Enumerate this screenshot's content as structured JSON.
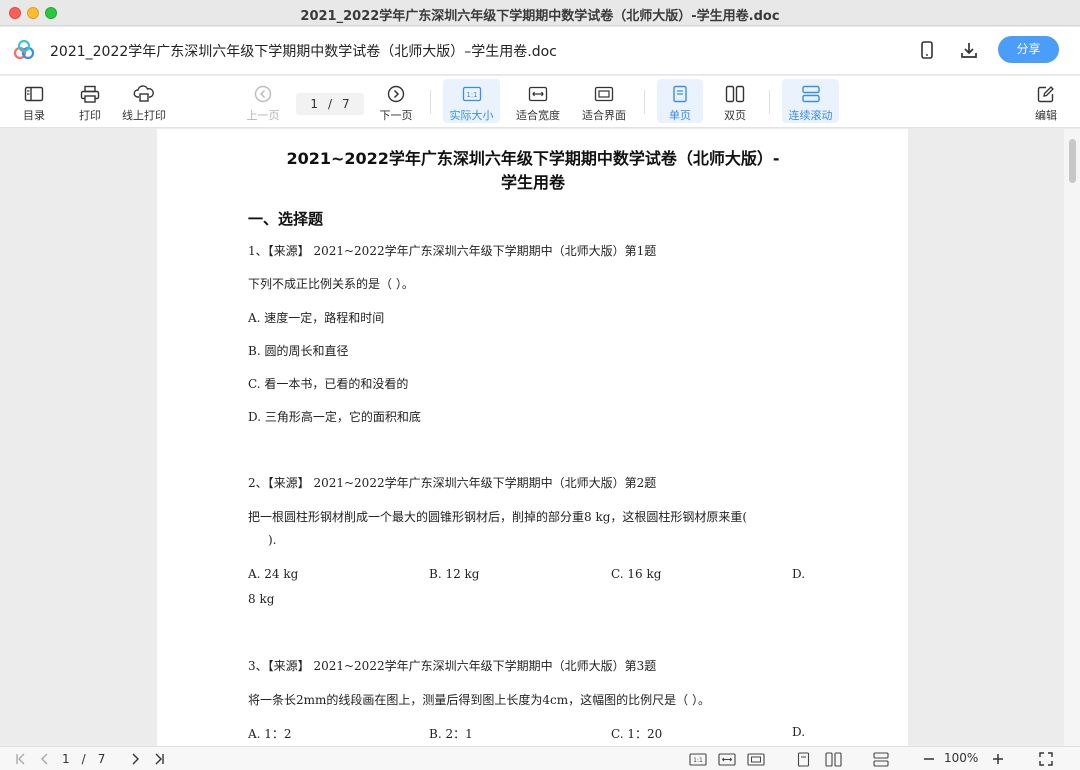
{
  "window": {
    "title": "2021_2022学年广东深圳六年级下学期期中数学试卷（北师大版）-学生用卷.doc"
  },
  "header": {
    "doc_name": "2021_2022学年广东深圳六年级下学期期中数学试卷（北师大版）–学生用卷.doc",
    "share_label": "分享"
  },
  "toolbar": {
    "toc": "目录",
    "print": "打印",
    "online_print": "线上打印",
    "prev": "上一页",
    "page_current": "1",
    "page_sep": "/",
    "page_total": "7",
    "next": "下一页",
    "actual_size": "实际大小",
    "fit_width": "适合宽度",
    "fit_screen": "适合界面",
    "single_page": "单页",
    "double_page": "双页",
    "continuous": "连续滚动",
    "edit": "编辑",
    "actual_size_icon_text": "1:1"
  },
  "document": {
    "title_line1": "2021~2022学年广东深圳六年级下学期期中数学试卷（北师大版）-",
    "title_line2": "学生用卷",
    "section": "一、选择题",
    "q1": {
      "source": "1、【来源】 2021~2022学年广东深圳六年级下学期期中（北师大版）第1题",
      "stem": "下列不成正比例关系的是（            ）。",
      "options": [
        "A. 速度一定，路程和时间",
        "B. 圆的周长和直径",
        "C. 看一本书，已看的和没看的",
        "D. 三角形高一定，它的面积和底"
      ]
    },
    "q2": {
      "source": "2、【来源】 2021~2022学年广东深圳六年级下学期期中（北师大版）第2题",
      "stem_line1": "把一根圆柱形钢材削成一个最大的圆锥形钢材后，削掉的部分重8 kg，这根圆柱形钢材原来重(",
      "stem_line2": ").",
      "options": [
        "A. 24 kg",
        "B. 12 kg",
        "C. 16 kg",
        "D."
      ],
      "option_d_value": "8 kg"
    },
    "q3": {
      "source": "3、【来源】 2021~2022学年广东深圳六年级下学期期中（北师大版）第3题",
      "stem": "将一条长2mm的线段画在图上，测量后得到图上长度为4cm，这幅图的比例尺是（            ）。",
      "options": [
        "A. 1：2",
        "B. 2：1",
        "C. 1：20",
        "D."
      ]
    }
  },
  "bottombar": {
    "page_current": "1",
    "page_sep": "/",
    "page_total": "7",
    "zoom": "100%",
    "actual_size_icon_text": "1:1"
  }
}
